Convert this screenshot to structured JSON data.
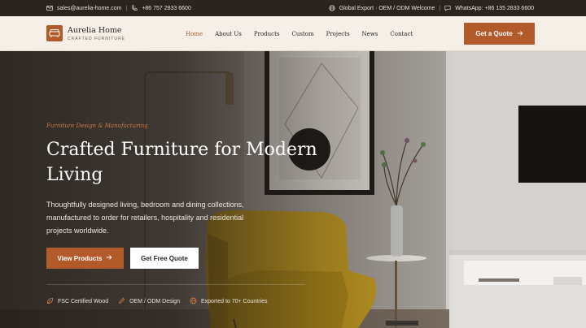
{
  "topbar": {
    "email": "sales@aurelia-home.com",
    "phone": "+86 757 2833 6600",
    "global": "Global Export · OEM / ODM Welcome",
    "whatsapp": "WhatsApp: +86 135 2833 6600"
  },
  "brand": {
    "name": "Aurelia Home",
    "tagline": "CRAFTED FURNITURE"
  },
  "nav": {
    "items": [
      "Home",
      "About Us",
      "Products",
      "Custom",
      "Projects",
      "News",
      "Contact"
    ],
    "active": "Home"
  },
  "header": {
    "cta_label": "Get a Quote"
  },
  "hero": {
    "eyebrow": "Furniture Design & Manufacturing",
    "title": "Crafted Furniture for Modern Living",
    "description": "Thoughtfully designed living, bedroom and dining collections, manufactured to order for retailers, hospitality and residential projects worldwide.",
    "primary_label": "View Products",
    "secondary_label": "Get Free Quote",
    "features": [
      "FSC Certified Wood",
      "OEM / ODM Design",
      "Exported to 70+ Countries"
    ]
  },
  "colors": {
    "accent": "#b35a2a",
    "dark": "#2a2420",
    "header_bg": "#f6efe7",
    "chair": "#c9a022"
  }
}
